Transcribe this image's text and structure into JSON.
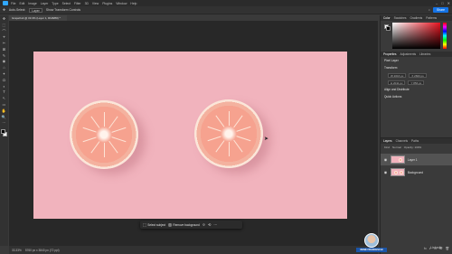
{
  "app": {
    "menu": [
      "File",
      "Edit",
      "Image",
      "Layer",
      "Type",
      "Select",
      "Filter",
      "3D",
      "View",
      "Plugins",
      "Window",
      "Help"
    ],
    "window_controls": [
      "–",
      "□",
      "✕"
    ],
    "share_label": "Share"
  },
  "options_bar": {
    "tool_label": "Auto-Select:",
    "target": "Layer",
    "show_transform": "Show Transform Controls"
  },
  "document": {
    "tab_title": "Grapefruit @ 33.3% (Layer 1, RGB/8#) *"
  },
  "tools": [
    "✥",
    "⬚",
    "⌒",
    "⌖",
    "✂",
    "⊠",
    "✎",
    "◉",
    "⌂",
    "✦",
    "⬭",
    "◐",
    "T",
    "↖",
    "▭",
    "✋",
    "🔍",
    "⋯"
  ],
  "taskbar": {
    "select_subject": "Select subject",
    "remove_background": "Remove background",
    "icons": [
      "⟐",
      "⟲",
      "⋯"
    ]
  },
  "statusbar": {
    "zoom": "33.33%",
    "doc_info": "5760 px x 3840 px (72 ppi)"
  },
  "right_panel": {
    "color_tabs": [
      "Color",
      "Swatches",
      "Gradients",
      "Patterns"
    ],
    "prop_tabs": [
      "Properties",
      "Adjustments",
      "Libraries"
    ],
    "prop_title": "Pixel Layer",
    "transform_label": "Transform",
    "w": "W 2016 px",
    "h": "H 2011 px",
    "x": "X 2843 px",
    "y": "Y 856 px",
    "align_label": "Align and Distribute",
    "quick_actions": "Quick Actions",
    "layers_tabs": [
      "Layers",
      "Channels",
      "Paths"
    ],
    "layer_filter": "Kind",
    "blend": "Normal",
    "opacity": "Opacity: 100%",
    "layers": [
      {
        "name": "Layer 1",
        "selected": true
      },
      {
        "name": "Background",
        "selected": false
      }
    ],
    "layer_footer_icons": [
      "fx",
      "◐",
      "▭",
      "⊞",
      "🗑"
    ]
  },
  "presenter": {
    "name": "RENÉ FRANCESCHI"
  },
  "watermark": "Linkedin"
}
